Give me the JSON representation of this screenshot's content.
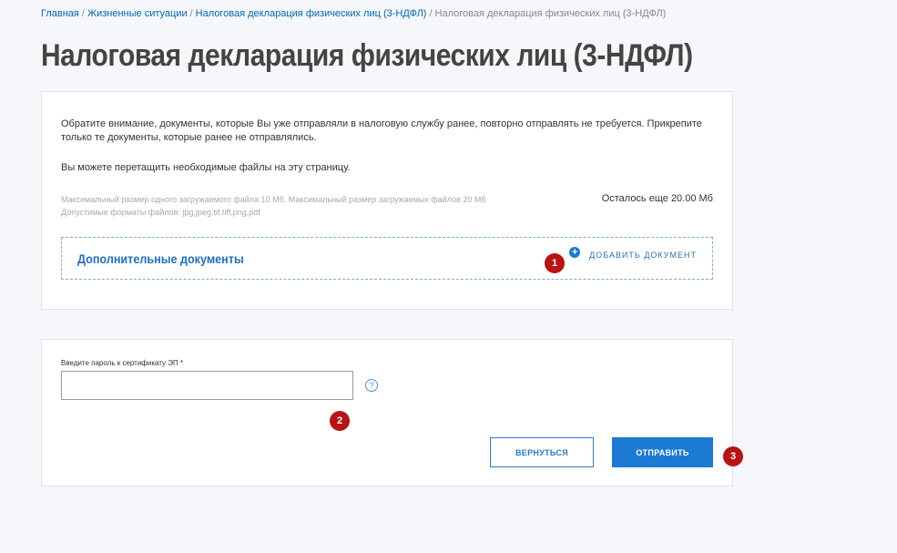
{
  "breadcrumb": {
    "items": [
      "Главная",
      "Жизненные ситуации",
      "Налоговая декларация физических лиц (3-НДФЛ)"
    ],
    "current": "Налоговая декларация физических лиц (3-НДФЛ)",
    "separator": "/"
  },
  "page": {
    "title": "Налоговая декларация физических лиц (3-НДФЛ)"
  },
  "documents": {
    "notice": "Обратите внимание, документы, которые Вы уже отправляли в налоговую службу ранее, повторно отправлять не требуется. Прикрепите только те документы, которые ранее не отправлялись.",
    "drag_note": "Вы можете перетащить необходимые файлы на эту страницу.",
    "limit_size": "Максимальный размер одного загружаемого файла 10 Мб. Максимальный размер загружаемых файлов 20 Мб",
    "limit_formats": "Допустимые форматы файлов: jpg,jpeg,tif,tiff,png,pdf",
    "remaining": "Осталось еще 20.00 Мб",
    "dropzone_title": "Дополнительные документы",
    "add_icon": "+",
    "add_label": "ДОБАВИТЬ ДОКУМЕНТ"
  },
  "certificate": {
    "label": "Введите пароль к сертификату ЭП *",
    "value": "",
    "help_icon": "?"
  },
  "actions": {
    "back_label": "ВЕРНУТЬСЯ",
    "send_label": "ОТПРАВИТЬ"
  },
  "markers": [
    "1",
    "2",
    "3"
  ],
  "colors": {
    "accent": "#1a7ad4",
    "link": "#0067b8",
    "marker": "#b81414",
    "background": "#f5f7fa"
  }
}
